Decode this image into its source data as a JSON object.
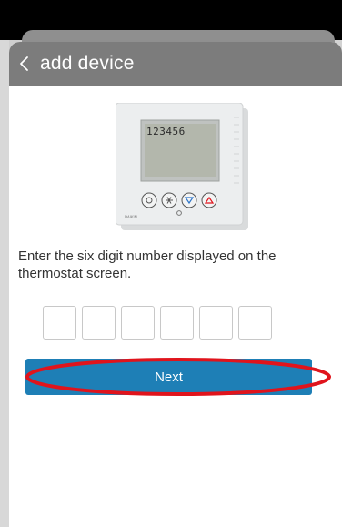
{
  "header": {
    "title": "add device",
    "back_icon": "chevron-left-icon"
  },
  "illustration": {
    "display_text": "123456",
    "brand_text": "DAIKIN",
    "buttons": [
      "fan-icon",
      "snowflake-icon",
      "down-arrow-icon",
      "up-arrow-icon"
    ]
  },
  "instruction": "Enter the six digit number displayed on the thermostat screen.",
  "code_inputs": [
    "",
    "",
    "",
    "",
    "",
    ""
  ],
  "next_button": {
    "label": "Next"
  },
  "colors": {
    "header": "#7c7c7c",
    "primary": "#1e7fb6",
    "highlight": "#e0141c",
    "down_arrow": "#2f76c9",
    "up_arrow": "#e0141c"
  }
}
